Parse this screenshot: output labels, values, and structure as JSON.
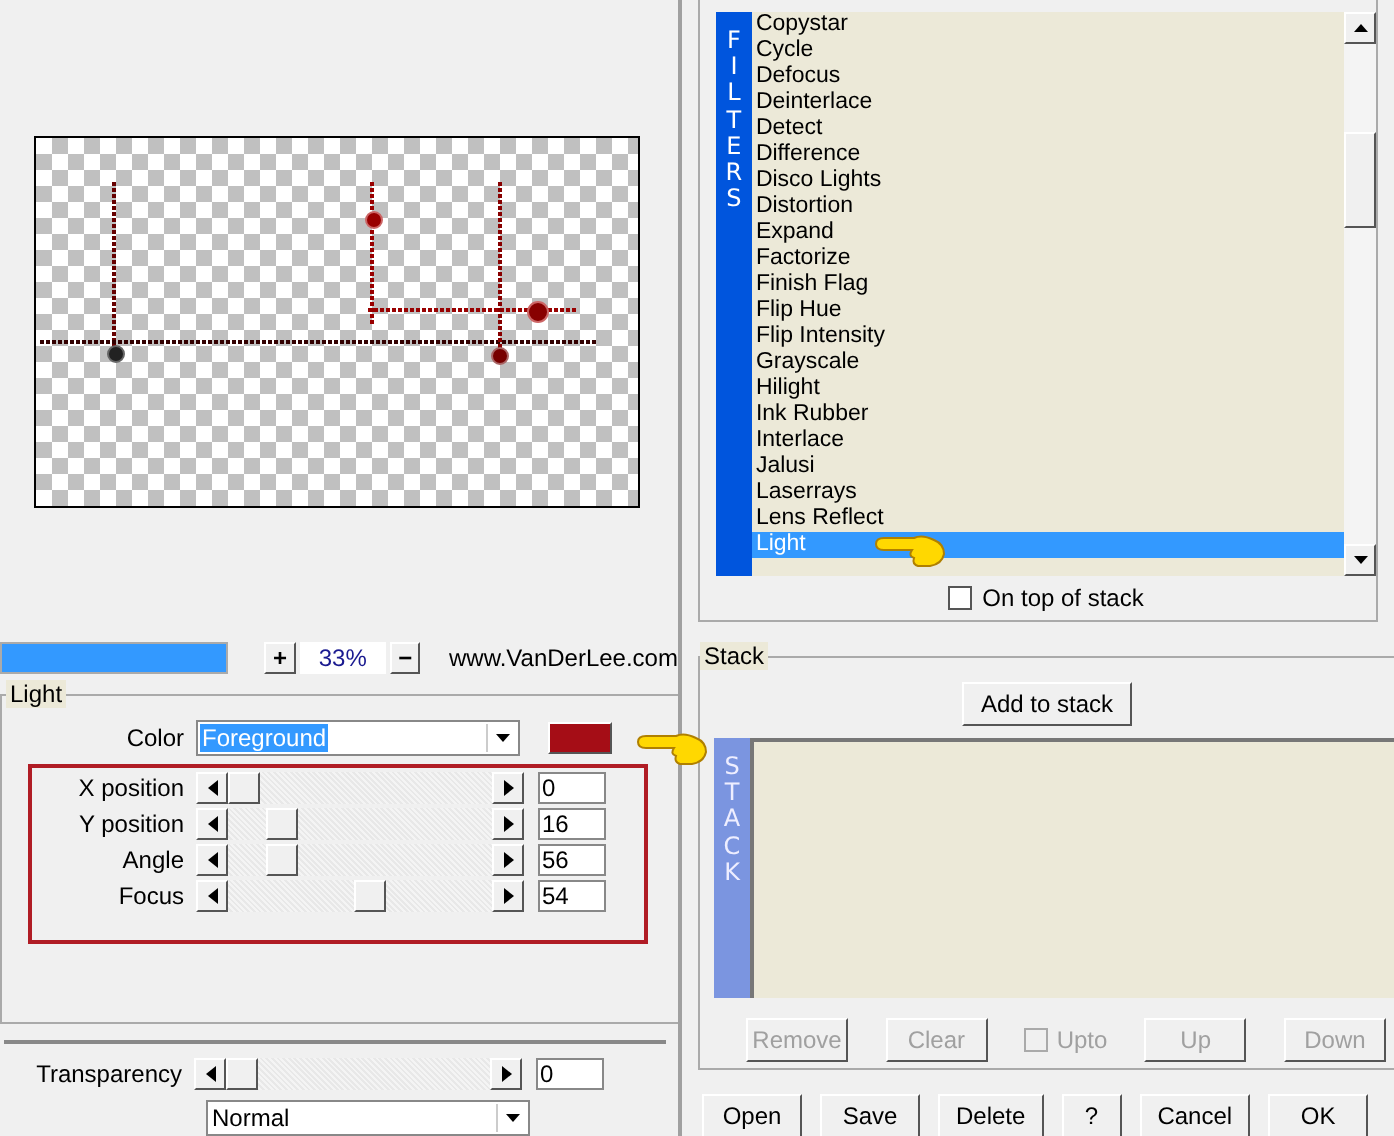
{
  "preview": {
    "zoom_in": "+",
    "zoom": "33%",
    "zoom_out": "−",
    "progress": {
      "level": 1
    },
    "website": "www.VanDerLee.com"
  },
  "light": {
    "title": "Light",
    "color": {
      "label": "Color",
      "value": "Foreground",
      "color": "#a50d16"
    },
    "sliders": [
      {
        "label": "X position",
        "value": "0",
        "level": 0
      },
      {
        "label": "Y position",
        "value": "16",
        "level": 0.16
      },
      {
        "label": "Angle",
        "value": "56",
        "level": 0.16
      },
      {
        "label": "Focus",
        "value": "54",
        "level": 0.54
      }
    ],
    "transparency": {
      "label": "Transparency",
      "value": "0",
      "level": 0
    },
    "blend_mode": "Normal"
  },
  "filters": {
    "strip": "FILTERS",
    "items": [
      {
        "label": "Copystar",
        "selected": false
      },
      {
        "label": "Cycle",
        "selected": false
      },
      {
        "label": "Defocus",
        "selected": false
      },
      {
        "label": "Deinterlace",
        "selected": false
      },
      {
        "label": "Detect",
        "selected": false
      },
      {
        "label": "Difference",
        "selected": false
      },
      {
        "label": "Disco Lights",
        "selected": false
      },
      {
        "label": "Distortion",
        "selected": false
      },
      {
        "label": "Expand",
        "selected": false
      },
      {
        "label": "Factorize",
        "selected": false
      },
      {
        "label": "Finish Flag",
        "selected": false
      },
      {
        "label": "Flip Hue",
        "selected": false
      },
      {
        "label": "Flip Intensity",
        "selected": false
      },
      {
        "label": "Grayscale",
        "selected": false
      },
      {
        "label": "Hilight",
        "selected": false
      },
      {
        "label": "Ink Rubber",
        "selected": false
      },
      {
        "label": "Interlace",
        "selected": false
      },
      {
        "label": "Jalusi",
        "selected": false
      },
      {
        "label": "Laserrays",
        "selected": false
      },
      {
        "label": "Lens Reflect",
        "selected": false
      },
      {
        "label": "Light",
        "selected": true
      }
    ],
    "on_top": {
      "label": "On top of stack",
      "checked": false
    }
  },
  "stack": {
    "title": "Stack",
    "add": "Add to stack",
    "strip": "STACK",
    "buttons": [
      {
        "kind": "button",
        "label": "Remove",
        "disabled": true
      },
      {
        "kind": "button",
        "label": "Clear",
        "disabled": true
      },
      {
        "kind": "checkbox",
        "label": "Upto",
        "disabled": true,
        "checked": false
      },
      {
        "kind": "button",
        "label": "Up",
        "disabled": true
      },
      {
        "kind": "button",
        "label": "Down",
        "disabled": true
      }
    ]
  },
  "buttons": [
    "Open",
    "Save",
    "Delete",
    "?",
    "Cancel",
    "OK"
  ]
}
